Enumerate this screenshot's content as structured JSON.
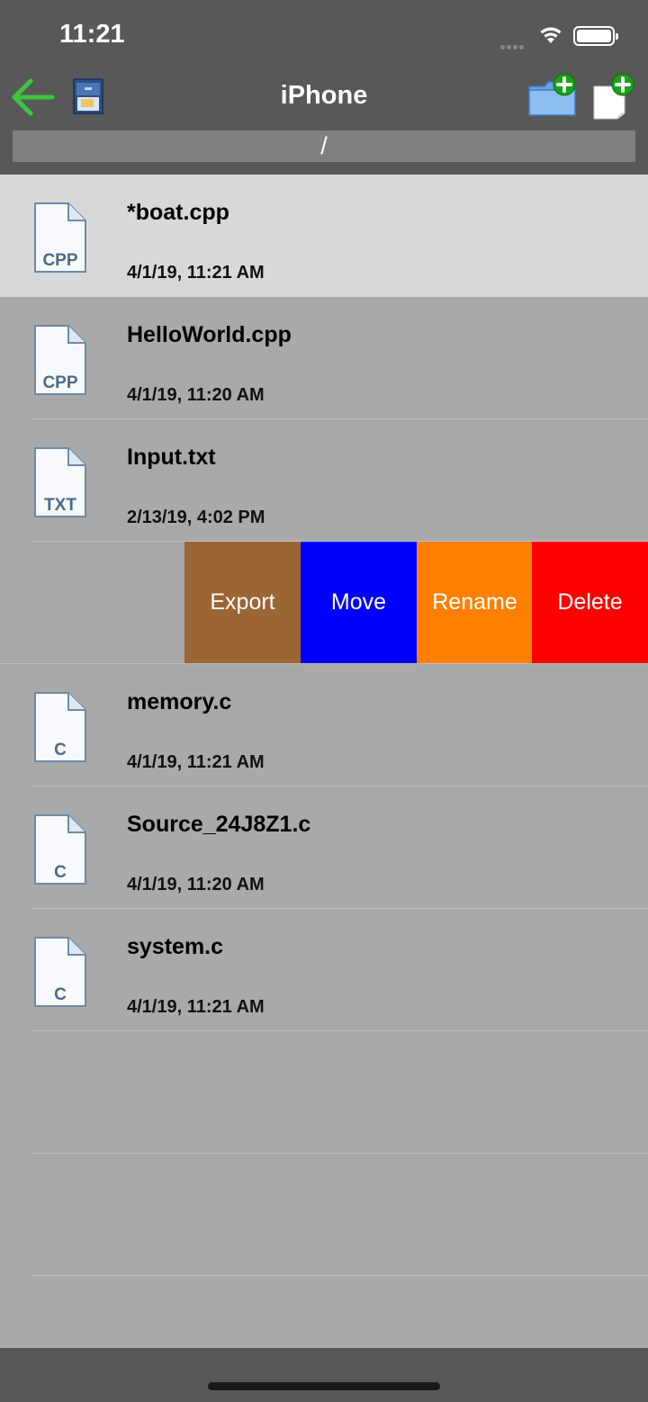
{
  "status_bar": {
    "time": "11:21"
  },
  "nav": {
    "title": "iPhone",
    "path": "/"
  },
  "files": [
    {
      "name": "*boat.cpp",
      "date": "4/1/19, 11:21 AM",
      "type_label": "CPP",
      "icon": "cpp-file-icon",
      "selected": true
    },
    {
      "name": "HelloWorld.cpp",
      "date": "4/1/19, 11:20 AM",
      "type_label": "CPP",
      "icon": "cpp-file-icon"
    },
    {
      "name": "Input.txt",
      "date": "2/13/19, 4:02 PM",
      "type_label": "TXT",
      "icon": "txt-file-icon"
    }
  ],
  "swipe_actions": {
    "export": "Export",
    "move": "Move",
    "rename": "Rename",
    "delete": "Delete"
  },
  "files_after": [
    {
      "name": "memory.c",
      "date": "4/1/19, 11:21 AM",
      "type_label": "C",
      "icon": "c-file-icon"
    },
    {
      "name": "Source_24J8Z1.c",
      "date": "4/1/19, 11:20 AM",
      "type_label": "C",
      "icon": "c-file-icon"
    },
    {
      "name": "system.c",
      "date": "4/1/19, 11:21 AM",
      "type_label": "C",
      "icon": "c-file-icon"
    }
  ],
  "colors": {
    "bar": "#585858",
    "list_background": "#a9a9a9",
    "selected_row": "#d8d8d8",
    "export": "#9b6534",
    "move": "#0000ff",
    "rename": "#ff8000",
    "delete": "#ff0000",
    "back_arrow": "#3ec43e"
  }
}
